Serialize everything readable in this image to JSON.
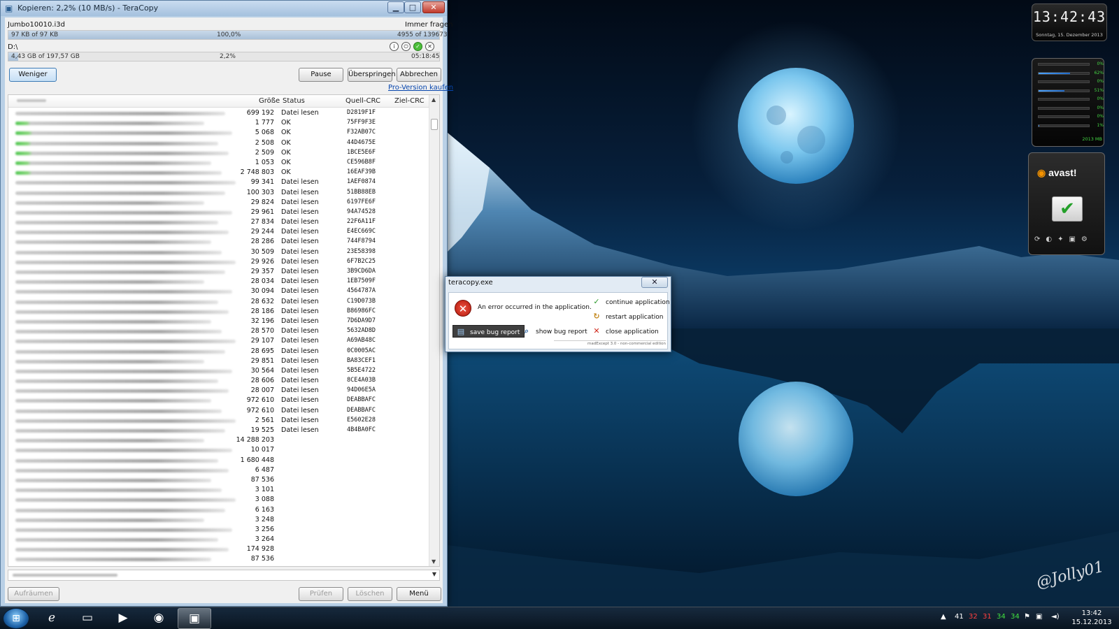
{
  "window": {
    "title": "Kopieren: 2,2%  (10 MB/s) - TeraCopy",
    "minimize": "▁",
    "maximize": "□",
    "close": "✕"
  },
  "file_transfer": {
    "current_file": "Jumbo10010.i3d",
    "overwrite_mode": "Immer fragen",
    "file_size_text": "97 KB of 97 KB",
    "file_percent": "100,0%",
    "file_progress": 1.0,
    "file_count": "4955 of 139673",
    "target_path": "D:\\",
    "total_size_text": "4,43 GB of 197,57 GB",
    "total_percent": "2,2%",
    "total_progress": 0.022,
    "time_remaining": "05:18:45"
  },
  "toolbar": {
    "less_label": "Weniger",
    "pause_label": "Pause",
    "skip_label": "Überspringen",
    "cancel_label": "Abbrechen",
    "pro_link": "Pro-Version kaufen"
  },
  "file_list": {
    "headers": {
      "size": "Größe",
      "status": "Status",
      "source_crc": "Quell-CRC",
      "target_crc": "Ziel-CRC"
    },
    "rows": [
      {
        "size": "699 192",
        "status": "Datei lesen",
        "crc": "D2819F1F",
        "ok": false
      },
      {
        "size": "1 777",
        "status": "OK",
        "crc": "75FF9F3E",
        "ok": true
      },
      {
        "size": "5 068",
        "status": "OK",
        "crc": "F32AB07C",
        "ok": true
      },
      {
        "size": "2 508",
        "status": "OK",
        "crc": "44D4675E",
        "ok": true
      },
      {
        "size": "2 509",
        "status": "OK",
        "crc": "1BCE5E6F",
        "ok": true
      },
      {
        "size": "1 053",
        "status": "OK",
        "crc": "CE596B8F",
        "ok": true
      },
      {
        "size": "2 748 803",
        "status": "OK",
        "crc": "16EAF39B",
        "ok": true
      },
      {
        "size": "99 341",
        "status": "Datei lesen",
        "crc": "1AEF0874",
        "ok": false
      },
      {
        "size": "100 303",
        "status": "Datei lesen",
        "crc": "51BB88EB",
        "ok": false
      },
      {
        "size": "29 824",
        "status": "Datei lesen",
        "crc": "6197FE6F",
        "ok": false
      },
      {
        "size": "29 961",
        "status": "Datei lesen",
        "crc": "94A74528",
        "ok": false
      },
      {
        "size": "27 834",
        "status": "Datei lesen",
        "crc": "22F6A11F",
        "ok": false
      },
      {
        "size": "29 244",
        "status": "Datei lesen",
        "crc": "E4EC669C",
        "ok": false
      },
      {
        "size": "28 286",
        "status": "Datei lesen",
        "crc": "744F8794",
        "ok": false
      },
      {
        "size": "30 509",
        "status": "Datei lesen",
        "crc": "23E58398",
        "ok": false
      },
      {
        "size": "29 926",
        "status": "Datei lesen",
        "crc": "6F7B2C25",
        "ok": false
      },
      {
        "size": "29 357",
        "status": "Datei lesen",
        "crc": "3B9CD6DA",
        "ok": false
      },
      {
        "size": "28 034",
        "status": "Datei lesen",
        "crc": "1EB7509F",
        "ok": false
      },
      {
        "size": "30 094",
        "status": "Datei lesen",
        "crc": "4564787A",
        "ok": false
      },
      {
        "size": "28 632",
        "status": "Datei lesen",
        "crc": "C19D073B",
        "ok": false
      },
      {
        "size": "28 186",
        "status": "Datei lesen",
        "crc": "B86986FC",
        "ok": false
      },
      {
        "size": "32 196",
        "status": "Datei lesen",
        "crc": "7D6DA9D7",
        "ok": false
      },
      {
        "size": "28 570",
        "status": "Datei lesen",
        "crc": "5632AD8D",
        "ok": false
      },
      {
        "size": "29 107",
        "status": "Datei lesen",
        "crc": "A69AB48C",
        "ok": false
      },
      {
        "size": "28 695",
        "status": "Datei lesen",
        "crc": "0C0005AC",
        "ok": false
      },
      {
        "size": "29 851",
        "status": "Datei lesen",
        "crc": "BA83CEF1",
        "ok": false
      },
      {
        "size": "30 564",
        "status": "Datei lesen",
        "crc": "5B5E4722",
        "ok": false
      },
      {
        "size": "28 606",
        "status": "Datei lesen",
        "crc": "8CE4A03B",
        "ok": false
      },
      {
        "size": "28 007",
        "status": "Datei lesen",
        "crc": "94D06E5A",
        "ok": false
      },
      {
        "size": "972 610",
        "status": "Datei lesen",
        "crc": "DEABBAFC",
        "ok": false
      },
      {
        "size": "972 610",
        "status": "Datei lesen",
        "crc": "DEABBAFC",
        "ok": false
      },
      {
        "size": "2 561",
        "status": "Datei lesen",
        "crc": "E5602E28",
        "ok": false
      },
      {
        "size": "19 525",
        "status": "Datei lesen",
        "crc": "4B4BA0FC",
        "ok": false
      },
      {
        "size": "14 288 203",
        "status": "",
        "crc": "",
        "ok": false
      },
      {
        "size": "10 017",
        "status": "",
        "crc": "",
        "ok": false
      },
      {
        "size": "1 680 448",
        "status": "",
        "crc": "",
        "ok": false
      },
      {
        "size": "6 487",
        "status": "",
        "crc": "",
        "ok": false
      },
      {
        "size": "87 536",
        "status": "",
        "crc": "",
        "ok": false
      },
      {
        "size": "3 101",
        "status": "",
        "crc": "",
        "ok": false
      },
      {
        "size": "3 088",
        "status": "",
        "crc": "",
        "ok": false
      },
      {
        "size": "6 163",
        "status": "",
        "crc": "",
        "ok": false
      },
      {
        "size": "3 248",
        "status": "",
        "crc": "",
        "ok": false
      },
      {
        "size": "3 256",
        "status": "",
        "crc": "",
        "ok": false
      },
      {
        "size": "3 264",
        "status": "",
        "crc": "",
        "ok": false
      },
      {
        "size": "174 928",
        "status": "",
        "crc": "",
        "ok": false
      },
      {
        "size": "87 536",
        "status": "",
        "crc": "",
        "ok": false
      }
    ]
  },
  "bottom_bar": {
    "clear_label": "Aufräumen",
    "verify_label": "Prüfen",
    "delete_label": "Löschen",
    "menu_label": "Menü"
  },
  "error_dialog": {
    "title": "teracopy.exe",
    "close": "✕",
    "message": "An error occurred in the application.",
    "continue_label": "continue application",
    "restart_label": "restart application",
    "save_report_label": "save bug report",
    "show_report_label": "show bug report",
    "close_app_label": "close application",
    "footer": "madExcept 3.0 - non-commercial edition"
  },
  "gadgets": {
    "clock_time": "13:42:43",
    "clock_date": "Sonntag, 15. Dezember 2013",
    "meter_readings": [
      "0%",
      "62%",
      "0%",
      "51%",
      "0%",
      "0%",
      "0%",
      "1%"
    ],
    "meter_fill": [
      0.0,
      0.62,
      0.0,
      0.51,
      0.0,
      0.0,
      0.0,
      0.01
    ],
    "memory": "2013 MB",
    "antivirus_name": "avast!"
  },
  "taskbar": {
    "tray_numbers": [
      "41",
      "32",
      "31",
      "34",
      "34"
    ],
    "tray_colors": [
      "#ffffff",
      "#ff4040",
      "#ff4040",
      "#40e040",
      "#40e040"
    ],
    "time": "13:42",
    "date": "15.12.2013"
  },
  "desktop": {
    "watermark": "@Jolly01"
  },
  "colors": {
    "accent": "#3d7bb5",
    "status_ok": "#3bbf3b",
    "error": "#d0281a"
  }
}
